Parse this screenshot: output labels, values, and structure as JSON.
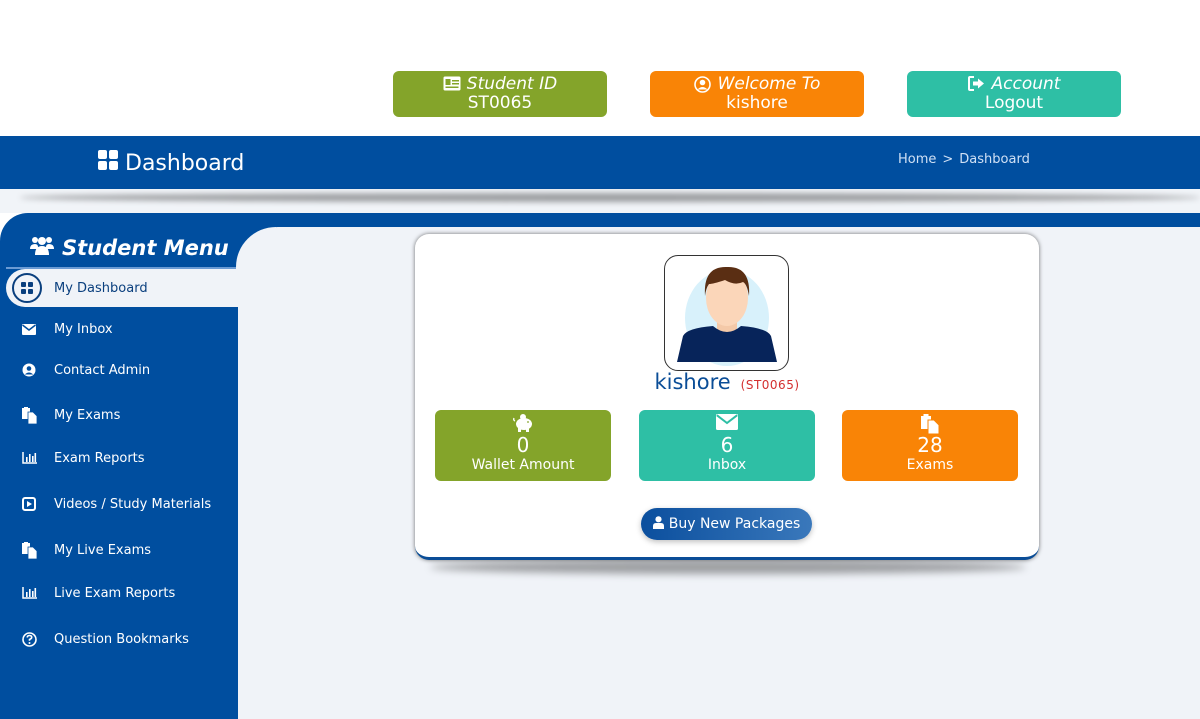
{
  "top_buttons": {
    "student_id": {
      "label": "Student ID",
      "value": "ST0065",
      "icon": "id-card-icon",
      "color": "#84a42a"
    },
    "welcome": {
      "label": "Welcome To",
      "value": "kishore",
      "icon": "user-circle-icon",
      "color": "#f98406"
    },
    "account": {
      "label": "Account",
      "value": "Logout",
      "icon": "sign-out-icon",
      "color": "#2ebfa5"
    }
  },
  "header": {
    "title": "Dashboard",
    "icon": "grid-icon",
    "breadcrumb": [
      "Home",
      "Dashboard"
    ],
    "breadcrumb_separator": ">"
  },
  "sidebar": {
    "title": "Student Menu",
    "title_icon": "users-icon",
    "items": [
      {
        "label": "My Dashboard",
        "icon": "grid-icon",
        "active": true
      },
      {
        "label": "My Inbox",
        "icon": "envelope-icon"
      },
      {
        "label": "Contact Admin",
        "icon": "user-circle-icon"
      },
      {
        "label": "My Exams",
        "icon": "copy-icon"
      },
      {
        "label": "Exam Reports",
        "icon": "bar-chart-icon"
      },
      {
        "label": "Videos / Study Materials",
        "icon": "play-square-icon"
      },
      {
        "label": "My Live Exams",
        "icon": "copy-icon"
      },
      {
        "label": "Live Exam Reports",
        "icon": "bar-chart-icon"
      },
      {
        "label": "Question Bookmarks",
        "icon": "question-circle-icon"
      }
    ]
  },
  "profile": {
    "name": "kishore",
    "student_id": "(ST0065)",
    "stats": [
      {
        "value": "0",
        "label": "Wallet Amount",
        "icon": "piggy-bank-icon",
        "color": "#84a42a"
      },
      {
        "value": "6",
        "label": "Inbox",
        "icon": "envelope-icon",
        "color": "#2ebfa5"
      },
      {
        "value": "28",
        "label": "Exams",
        "icon": "copy-icon",
        "color": "#f98406"
      }
    ],
    "buy_button": "Buy New Packages"
  },
  "colors": {
    "primary": "#004e9f",
    "background": "#f0f3f8",
    "accent_red": "#d32f2f"
  }
}
